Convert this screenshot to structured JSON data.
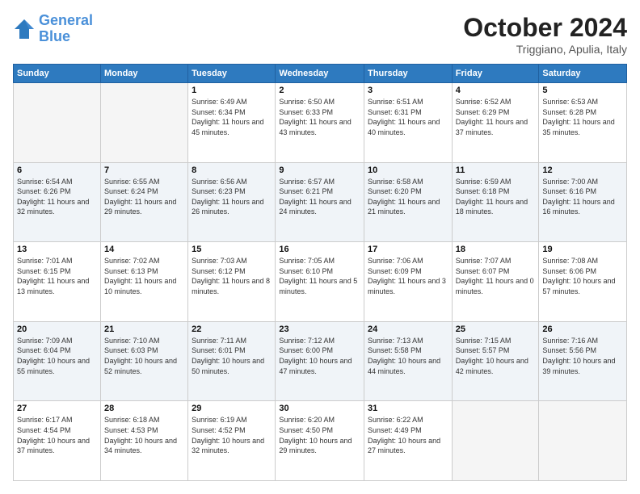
{
  "header": {
    "logo_line1": "General",
    "logo_line2": "Blue",
    "month": "October 2024",
    "location": "Triggiano, Apulia, Italy"
  },
  "days_of_week": [
    "Sunday",
    "Monday",
    "Tuesday",
    "Wednesday",
    "Thursday",
    "Friday",
    "Saturday"
  ],
  "weeks": [
    [
      {
        "day": "",
        "info": ""
      },
      {
        "day": "",
        "info": ""
      },
      {
        "day": "1",
        "info": "Sunrise: 6:49 AM\nSunset: 6:34 PM\nDaylight: 11 hours and 45 minutes."
      },
      {
        "day": "2",
        "info": "Sunrise: 6:50 AM\nSunset: 6:33 PM\nDaylight: 11 hours and 43 minutes."
      },
      {
        "day": "3",
        "info": "Sunrise: 6:51 AM\nSunset: 6:31 PM\nDaylight: 11 hours and 40 minutes."
      },
      {
        "day": "4",
        "info": "Sunrise: 6:52 AM\nSunset: 6:29 PM\nDaylight: 11 hours and 37 minutes."
      },
      {
        "day": "5",
        "info": "Sunrise: 6:53 AM\nSunset: 6:28 PM\nDaylight: 11 hours and 35 minutes."
      }
    ],
    [
      {
        "day": "6",
        "info": "Sunrise: 6:54 AM\nSunset: 6:26 PM\nDaylight: 11 hours and 32 minutes."
      },
      {
        "day": "7",
        "info": "Sunrise: 6:55 AM\nSunset: 6:24 PM\nDaylight: 11 hours and 29 minutes."
      },
      {
        "day": "8",
        "info": "Sunrise: 6:56 AM\nSunset: 6:23 PM\nDaylight: 11 hours and 26 minutes."
      },
      {
        "day": "9",
        "info": "Sunrise: 6:57 AM\nSunset: 6:21 PM\nDaylight: 11 hours and 24 minutes."
      },
      {
        "day": "10",
        "info": "Sunrise: 6:58 AM\nSunset: 6:20 PM\nDaylight: 11 hours and 21 minutes."
      },
      {
        "day": "11",
        "info": "Sunrise: 6:59 AM\nSunset: 6:18 PM\nDaylight: 11 hours and 18 minutes."
      },
      {
        "day": "12",
        "info": "Sunrise: 7:00 AM\nSunset: 6:16 PM\nDaylight: 11 hours and 16 minutes."
      }
    ],
    [
      {
        "day": "13",
        "info": "Sunrise: 7:01 AM\nSunset: 6:15 PM\nDaylight: 11 hours and 13 minutes."
      },
      {
        "day": "14",
        "info": "Sunrise: 7:02 AM\nSunset: 6:13 PM\nDaylight: 11 hours and 10 minutes."
      },
      {
        "day": "15",
        "info": "Sunrise: 7:03 AM\nSunset: 6:12 PM\nDaylight: 11 hours and 8 minutes."
      },
      {
        "day": "16",
        "info": "Sunrise: 7:05 AM\nSunset: 6:10 PM\nDaylight: 11 hours and 5 minutes."
      },
      {
        "day": "17",
        "info": "Sunrise: 7:06 AM\nSunset: 6:09 PM\nDaylight: 11 hours and 3 minutes."
      },
      {
        "day": "18",
        "info": "Sunrise: 7:07 AM\nSunset: 6:07 PM\nDaylight: 11 hours and 0 minutes."
      },
      {
        "day": "19",
        "info": "Sunrise: 7:08 AM\nSunset: 6:06 PM\nDaylight: 10 hours and 57 minutes."
      }
    ],
    [
      {
        "day": "20",
        "info": "Sunrise: 7:09 AM\nSunset: 6:04 PM\nDaylight: 10 hours and 55 minutes."
      },
      {
        "day": "21",
        "info": "Sunrise: 7:10 AM\nSunset: 6:03 PM\nDaylight: 10 hours and 52 minutes."
      },
      {
        "day": "22",
        "info": "Sunrise: 7:11 AM\nSunset: 6:01 PM\nDaylight: 10 hours and 50 minutes."
      },
      {
        "day": "23",
        "info": "Sunrise: 7:12 AM\nSunset: 6:00 PM\nDaylight: 10 hours and 47 minutes."
      },
      {
        "day": "24",
        "info": "Sunrise: 7:13 AM\nSunset: 5:58 PM\nDaylight: 10 hours and 44 minutes."
      },
      {
        "day": "25",
        "info": "Sunrise: 7:15 AM\nSunset: 5:57 PM\nDaylight: 10 hours and 42 minutes."
      },
      {
        "day": "26",
        "info": "Sunrise: 7:16 AM\nSunset: 5:56 PM\nDaylight: 10 hours and 39 minutes."
      }
    ],
    [
      {
        "day": "27",
        "info": "Sunrise: 6:17 AM\nSunset: 4:54 PM\nDaylight: 10 hours and 37 minutes."
      },
      {
        "day": "28",
        "info": "Sunrise: 6:18 AM\nSunset: 4:53 PM\nDaylight: 10 hours and 34 minutes."
      },
      {
        "day": "29",
        "info": "Sunrise: 6:19 AM\nSunset: 4:52 PM\nDaylight: 10 hours and 32 minutes."
      },
      {
        "day": "30",
        "info": "Sunrise: 6:20 AM\nSunset: 4:50 PM\nDaylight: 10 hours and 29 minutes."
      },
      {
        "day": "31",
        "info": "Sunrise: 6:22 AM\nSunset: 4:49 PM\nDaylight: 10 hours and 27 minutes."
      },
      {
        "day": "",
        "info": ""
      },
      {
        "day": "",
        "info": ""
      }
    ]
  ]
}
